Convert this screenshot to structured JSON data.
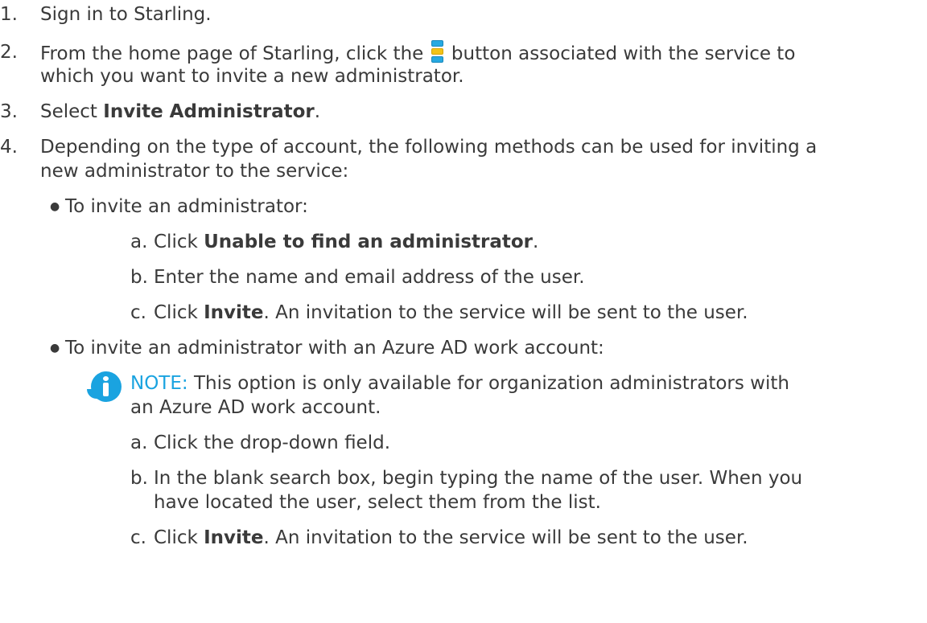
{
  "steps": [
    {
      "num": "1.",
      "text": "Sign in to Starling."
    },
    {
      "num": "2.",
      "pre": "From the home page of Starling, click the",
      "post": "button associated with the service to",
      "line2": "which you want to invite a new administrator."
    },
    {
      "num": "3.",
      "pre": "Select ",
      "bold": "Invite Administrator",
      "post": "."
    },
    {
      "num": "4.",
      "line1": "Depending on the type of account, the following methods can be used for inviting a",
      "line2": "new administrator to the service:"
    }
  ],
  "bullets": [
    {
      "text": "To invite an administrator:",
      "substeps": [
        {
          "letter": "a.",
          "pre": "Click ",
          "bold": "Unable to find an administrator",
          "post": "."
        },
        {
          "letter": "b.",
          "text": "Enter the name and email address of the user."
        },
        {
          "letter": "c.",
          "pre": "Click ",
          "bold": "Invite",
          "post": ". An invitation to the service will be sent to the user."
        }
      ]
    },
    {
      "text": "To invite an administrator with an Azure AD work account:",
      "note": {
        "label": "NOTE:",
        "line1": " This option is only available for organization administrators with",
        "line2": "an Azure AD work account."
      },
      "substeps": [
        {
          "letter": "a.",
          "text": "Click the drop-down field."
        },
        {
          "letter": "b.",
          "text": "In the blank search box, begin typing the name of the user. When you",
          "line2": "have located the user, select them from the list."
        },
        {
          "letter": "c.",
          "pre": "Click ",
          "bold": "Invite",
          "post": ". An invitation to the service will be sent to the user."
        }
      ]
    }
  ],
  "icons": {
    "menu_button": "vertical-ellipsis-menu-icon",
    "note": "info-icon"
  },
  "colors": {
    "text": "#3a3a3a",
    "note_accent": "#1aa3e0",
    "menu_icon_blue": "#27a9e1",
    "menu_icon_yellow": "#f2c318"
  }
}
